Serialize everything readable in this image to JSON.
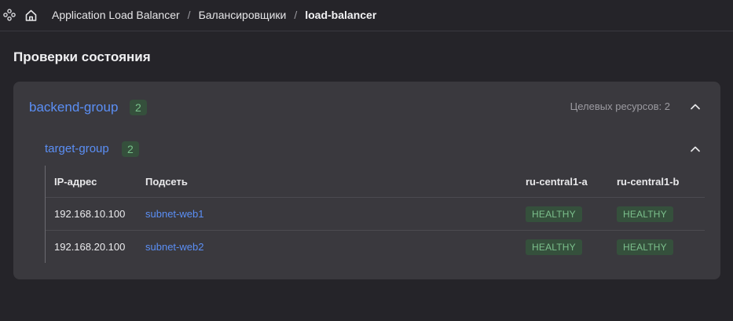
{
  "breadcrumb": {
    "items": [
      "Application Load Balancer",
      "Балансировщики",
      "load-balancer"
    ],
    "separator": "/"
  },
  "page": {
    "title": "Проверки состояния"
  },
  "backend_group": {
    "name": "backend-group",
    "count": "2",
    "targets_label": "Целевых ресурсов: 2"
  },
  "target_group": {
    "name": "target-group",
    "count": "2",
    "columns": [
      "IP-адрес",
      "Подсеть",
      "ru-central1-a",
      "ru-central1-b"
    ],
    "rows": [
      {
        "ip": "192.168.10.100",
        "subnet": "subnet-web1",
        "zone_a": "HEALTHY",
        "zone_b": "HEALTHY"
      },
      {
        "ip": "192.168.20.100",
        "subnet": "subnet-web2",
        "zone_a": "HEALTHY",
        "zone_b": "HEALTHY"
      }
    ]
  },
  "icons": [
    "nodes-icon",
    "home-icon",
    "chevron-up-icon"
  ],
  "colors": {
    "background": "#252429",
    "card": "#3a393e",
    "link": "#5b8ff5",
    "healthy_bg": "#35503c",
    "healthy_text": "#7bbf8c"
  }
}
